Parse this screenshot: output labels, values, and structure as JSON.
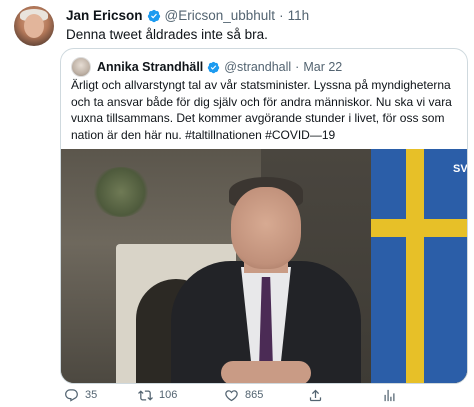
{
  "tweet": {
    "author_name": "Jan Ericson",
    "author_handle": "@Ericson_ubbhult",
    "separator": "·",
    "time": "11h",
    "text": "Denna tweet åldrades inte så bra."
  },
  "quoted": {
    "author_name": "Annika Strandhäll",
    "author_handle": "@strandhall",
    "separator": "·",
    "date": "Mar 22",
    "text": "Ärligt och allvarstyngt tal av vår statsminister. Lyssna på myndigheterna och ta ansvar både för dig själv och för andra människor. Nu ska vi vara vuxna tillsammans. Det kommer avgörande stunder i livet, för oss som nation är den här nu. #taltillnationen #COVID—19",
    "video_overlay": "SV"
  },
  "actions": {
    "reply_count": "35",
    "retweet_count": "106",
    "like_count": "865"
  },
  "colors": {
    "verified": "#1d9bf0",
    "muted_text": "#536471",
    "border": "#cfd9de"
  },
  "icons": [
    "verified-icon",
    "reply-icon",
    "retweet-icon",
    "like-icon",
    "share-icon",
    "stats-icon"
  ]
}
